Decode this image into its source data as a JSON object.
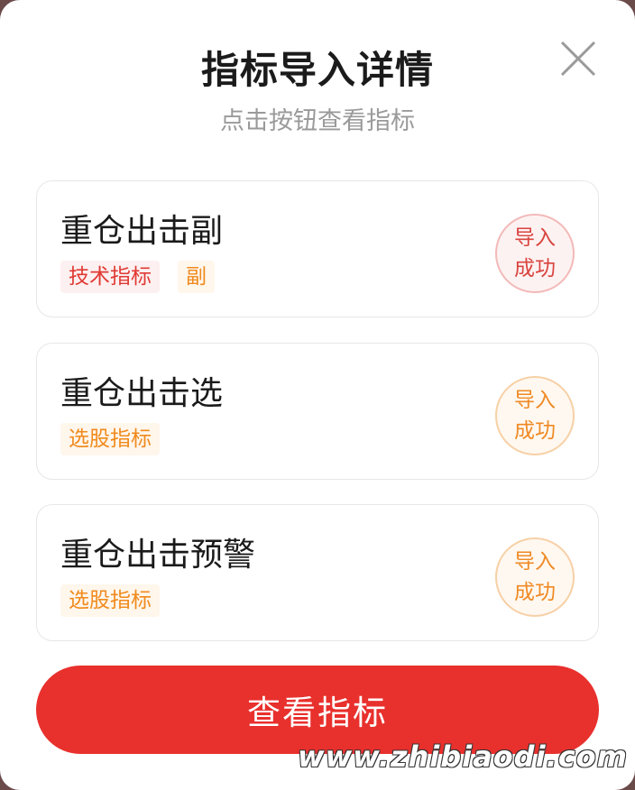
{
  "dialog": {
    "title": "指标导入详情",
    "subtitle": "点击按钮查看指标"
  },
  "close_icon": "close-icon",
  "cards": [
    {
      "name": "重仓出击副",
      "tags": [
        {
          "label": "技术指标",
          "color": "#e03a34"
        },
        {
          "label": "副",
          "color": "#f08a1c"
        }
      ],
      "status_line1": "导入",
      "status_line2": "成功",
      "status_color": "#d9443f"
    },
    {
      "name": "重仓出击选",
      "tags": [
        {
          "label": "选股指标",
          "color": "#f08a1c"
        }
      ],
      "status_line1": "导入",
      "status_line2": "成功",
      "status_color": "#ef8a25"
    },
    {
      "name": "重仓出击预警",
      "tags": [
        {
          "label": "选股指标",
          "color": "#f08a1c"
        }
      ],
      "status_line1": "导入",
      "status_line2": "成功",
      "status_color": "#ef8a25"
    }
  ],
  "primary_button": {
    "label": "查看指标",
    "color": "#e8302d"
  },
  "watermark": "www.zhibiaodi.com"
}
